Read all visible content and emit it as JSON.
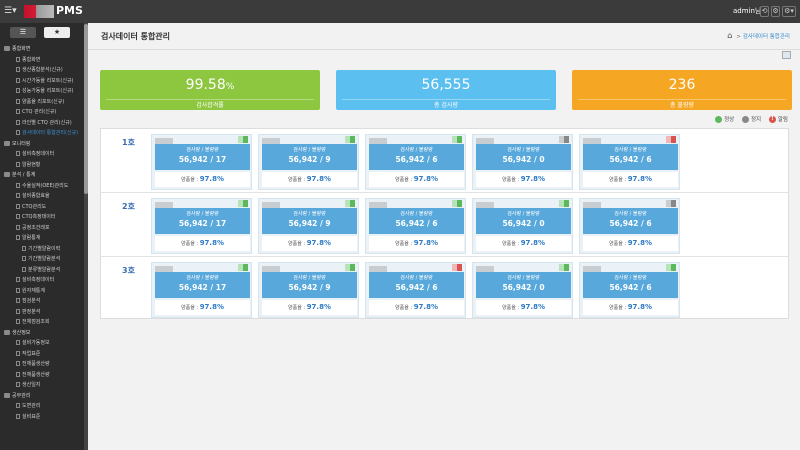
{
  "app": {
    "title": "PMS",
    "user": "admin님"
  },
  "sidebar": {
    "tabs": [
      {
        "label": "☰"
      },
      {
        "label": "★"
      }
    ],
    "items": [
      {
        "label": "종합화면",
        "level": "g"
      },
      {
        "label": "종합화면",
        "level": "c"
      },
      {
        "label": "생산종합분석(신규)",
        "level": "c"
      },
      {
        "label": "시간가동율 리포트(신규)",
        "level": "c"
      },
      {
        "label": "성능가동율 리포트(신규)",
        "level": "c"
      },
      {
        "label": "양품율 리포트(신규)",
        "level": "c"
      },
      {
        "label": "CTQ 관리(신규)",
        "level": "c"
      },
      {
        "label": "라인별 CTQ 관리(신규)",
        "level": "c"
      },
      {
        "label": "검사데이터 통합관리(신규)",
        "level": "c",
        "active": true
      },
      {
        "label": "모니터링",
        "level": "g"
      },
      {
        "label": "설비측정데이터",
        "level": "c"
      },
      {
        "label": "알람현황",
        "level": "c"
      },
      {
        "label": "분석 / 통계",
        "level": "g"
      },
      {
        "label": "수율실적(OEE)관리도",
        "level": "c"
      },
      {
        "label": "설비종합효율",
        "level": "c"
      },
      {
        "label": "CTQ관리도",
        "level": "c"
      },
      {
        "label": "CTQ측정데이터",
        "level": "c"
      },
      {
        "label": "공정조건레포",
        "level": "c"
      },
      {
        "label": "알람통계",
        "level": "c"
      },
      {
        "label": "기간별알람이력",
        "level": "d"
      },
      {
        "label": "기간별알람분석",
        "level": "d"
      },
      {
        "label": "분류별알람분석",
        "level": "d"
      },
      {
        "label": "설비측정데이터",
        "level": "c"
      },
      {
        "label": "원자재통계",
        "level": "c"
      },
      {
        "label": "점검분석",
        "level": "c"
      },
      {
        "label": "판정분석",
        "level": "c"
      },
      {
        "label": "전체점검조회",
        "level": "c"
      },
      {
        "label": "생산정보",
        "level": "g"
      },
      {
        "label": "설비가동정보",
        "level": "c"
      },
      {
        "label": "작업표준",
        "level": "c"
      },
      {
        "label": "전체품생산량",
        "level": "c"
      },
      {
        "label": "전체품생산량",
        "level": "c"
      },
      {
        "label": "생산일지",
        "level": "c"
      },
      {
        "label": "공무관리",
        "level": "g"
      },
      {
        "label": "도면관리",
        "level": "c"
      },
      {
        "label": "설비표준",
        "level": "c"
      }
    ]
  },
  "page": {
    "title": "검사데이터 통합관리",
    "breadcrumb": {
      "sep": ">",
      "current": "검사데이터 통합관리"
    }
  },
  "kpis": [
    {
      "value": "99.58",
      "unit": "%",
      "label": "검사합격률",
      "color": "#8dc63f"
    },
    {
      "value": "56,555",
      "unit": "",
      "label": "총 검사량",
      "color": "#5bc0f0"
    },
    {
      "value": "236",
      "unit": "",
      "label": "총 불량량",
      "color": "#f5a623"
    }
  ],
  "legend": [
    {
      "label": "정상",
      "color": "#5cb85c",
      "glyph": ""
    },
    {
      "label": "정지",
      "color": "#888888",
      "glyph": ""
    },
    {
      "label": "알림",
      "color": "#d9534f",
      "glyph": "!"
    }
  ],
  "rows": [
    {
      "label": "1호",
      "cards": [
        {
          "caption": "검사량 / 불량량",
          "count": "56,942 / 17",
          "rate_label": "양품율 :",
          "rate": "97.8%",
          "status": [
            "#b8e2b8",
            "#5cb85c"
          ]
        },
        {
          "caption": "검사량 / 불량량",
          "count": "56,942 / 9",
          "rate_label": "양품율 :",
          "rate": "97.8%",
          "status": [
            "#b8e2b8",
            "#5cb85c"
          ]
        },
        {
          "caption": "검사량 / 불량량",
          "count": "56,942 / 6",
          "rate_label": "양품율 :",
          "rate": "97.8%",
          "status": [
            "#b8e2b8",
            "#5cb85c"
          ]
        },
        {
          "caption": "검사량 / 불량량",
          "count": "56,942 / 0",
          "rate_label": "양품율 :",
          "rate": "97.8%",
          "status": [
            "#cccccc",
            "#888888"
          ]
        },
        {
          "caption": "검사량 / 불량량",
          "count": "56,942 / 6",
          "rate_label": "양품율 :",
          "rate": "97.8%",
          "status": [
            "#f0b8b8",
            "#d9534f"
          ]
        }
      ]
    },
    {
      "label": "2호",
      "cards": [
        {
          "caption": "검사량 / 불량량",
          "count": "56,942 / 17",
          "rate_label": "양품율 :",
          "rate": "97.8%",
          "status": [
            "#b8e2b8",
            "#5cb85c"
          ]
        },
        {
          "caption": "검사량 / 불량량",
          "count": "56,942 / 9",
          "rate_label": "양품율 :",
          "rate": "97.8%",
          "status": [
            "#b8e2b8",
            "#5cb85c"
          ]
        },
        {
          "caption": "검사량 / 불량량",
          "count": "56,942 / 6",
          "rate_label": "양품율 :",
          "rate": "97.8%",
          "status": [
            "#b8e2b8",
            "#5cb85c"
          ]
        },
        {
          "caption": "검사량 / 불량량",
          "count": "56,942 / 0",
          "rate_label": "양품율 :",
          "rate": "97.8%",
          "status": [
            "#b8e2b8",
            "#5cb85c"
          ]
        },
        {
          "caption": "검사량 / 불량량",
          "count": "56,942 / 6",
          "rate_label": "양품율 :",
          "rate": "97.8%",
          "status": [
            "#cccccc",
            "#888888"
          ]
        }
      ]
    },
    {
      "label": "3호",
      "cards": [
        {
          "caption": "검사량 / 불량량",
          "count": "56,942 / 17",
          "rate_label": "양품율 :",
          "rate": "97.8%",
          "status": [
            "#b8e2b8",
            "#5cb85c"
          ]
        },
        {
          "caption": "검사량 / 불량량",
          "count": "56,942 / 9",
          "rate_label": "양품율 :",
          "rate": "97.8%",
          "status": [
            "#b8e2b8",
            "#5cb85c"
          ]
        },
        {
          "caption": "검사량 / 불량량",
          "count": "56,942 / 6",
          "rate_label": "양품율 :",
          "rate": "97.8%",
          "status": [
            "#f0b8b8",
            "#d9534f"
          ]
        },
        {
          "caption": "검사량 / 불량량",
          "count": "56,942 / 0",
          "rate_label": "양품율 :",
          "rate": "97.8%",
          "status": [
            "#b8e2b8",
            "#5cb85c"
          ]
        },
        {
          "caption": "검사량 / 불량량",
          "count": "56,942 / 6",
          "rate_label": "양품율 :",
          "rate": "97.8%",
          "status": [
            "#b8e2b8",
            "#5cb85c"
          ]
        }
      ]
    }
  ]
}
